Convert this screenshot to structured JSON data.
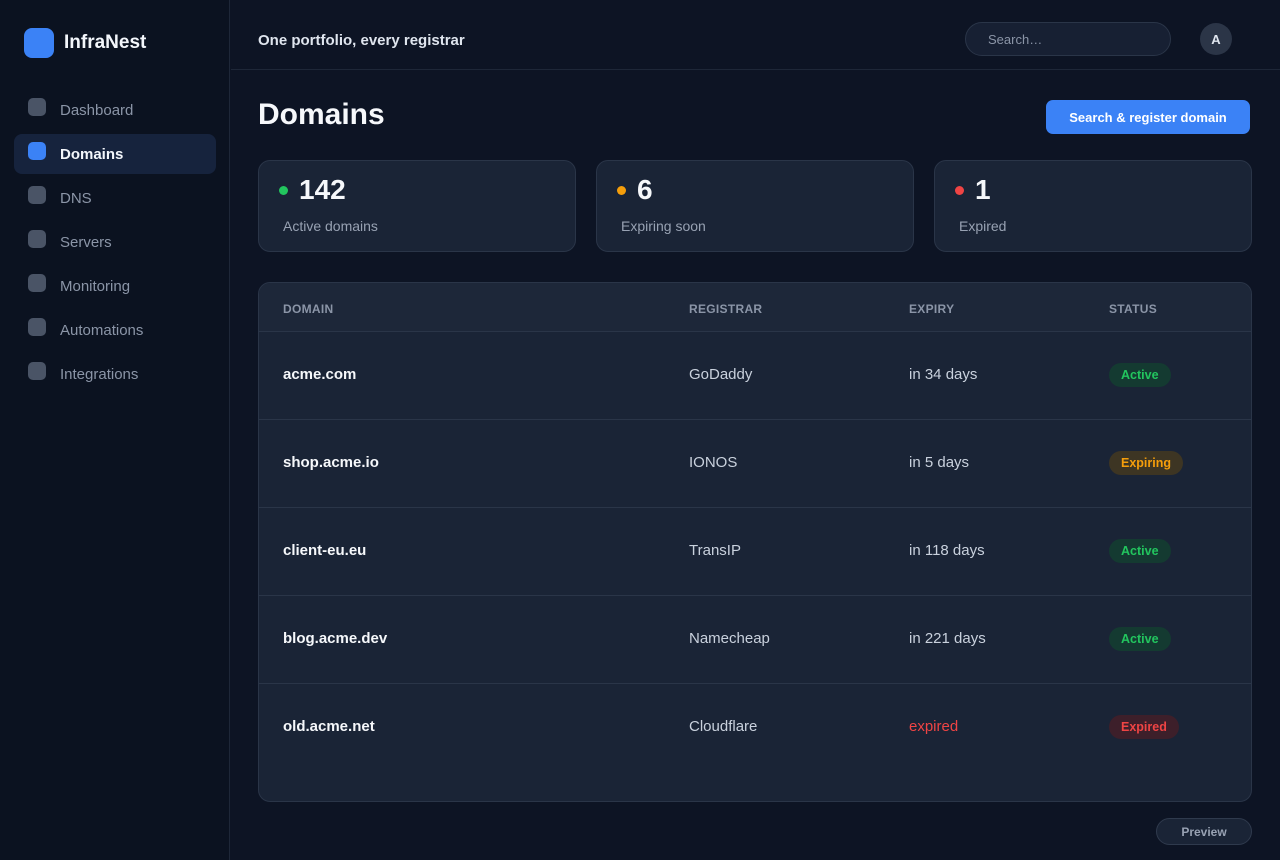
{
  "app": {
    "name": "InfraNest",
    "accent": "#3b82f6"
  },
  "sidebar": {
    "items": [
      {
        "label": "Dashboard",
        "active": false
      },
      {
        "label": "Domains",
        "active": true
      },
      {
        "label": "DNS",
        "active": false
      },
      {
        "label": "Servers",
        "active": false
      },
      {
        "label": "Monitoring",
        "active": false
      },
      {
        "label": "Automations",
        "active": false
      },
      {
        "label": "Integrations",
        "active": false
      }
    ]
  },
  "header": {
    "tagline": "One portfolio, every registrar",
    "search_placeholder": "Search…",
    "avatar_initial": "A"
  },
  "main": {
    "title": "Domains",
    "primary_action": "Search & register domain",
    "stats": [
      {
        "value": "142",
        "label": "Active domains",
        "color": "#22c55e"
      },
      {
        "value": "6",
        "label": "Expiring soon",
        "color": "#f59e0b"
      },
      {
        "value": "1",
        "label": "Expired",
        "color": "#ef4444"
      }
    ],
    "table": {
      "headers": [
        "DOMAIN",
        "REGISTRAR",
        "EXPIRY",
        "STATUS"
      ],
      "rows": [
        {
          "domain": "acme.com",
          "registrar": "GoDaddy",
          "expiry": "in 34 days",
          "status": "Active"
        },
        {
          "domain": "shop.acme.io",
          "registrar": "IONOS",
          "expiry": "in 5 days",
          "status": "Expiring"
        },
        {
          "domain": "client-eu.eu",
          "registrar": "TransIP",
          "expiry": "in 118 days",
          "status": "Active"
        },
        {
          "domain": "blog.acme.dev",
          "registrar": "Namecheap",
          "expiry": "in 221 days",
          "status": "Active"
        },
        {
          "domain": "old.acme.net",
          "registrar": "Cloudflare",
          "expiry": "expired",
          "status": "Expired"
        }
      ]
    }
  },
  "footer": {
    "preview_label": "Preview"
  }
}
